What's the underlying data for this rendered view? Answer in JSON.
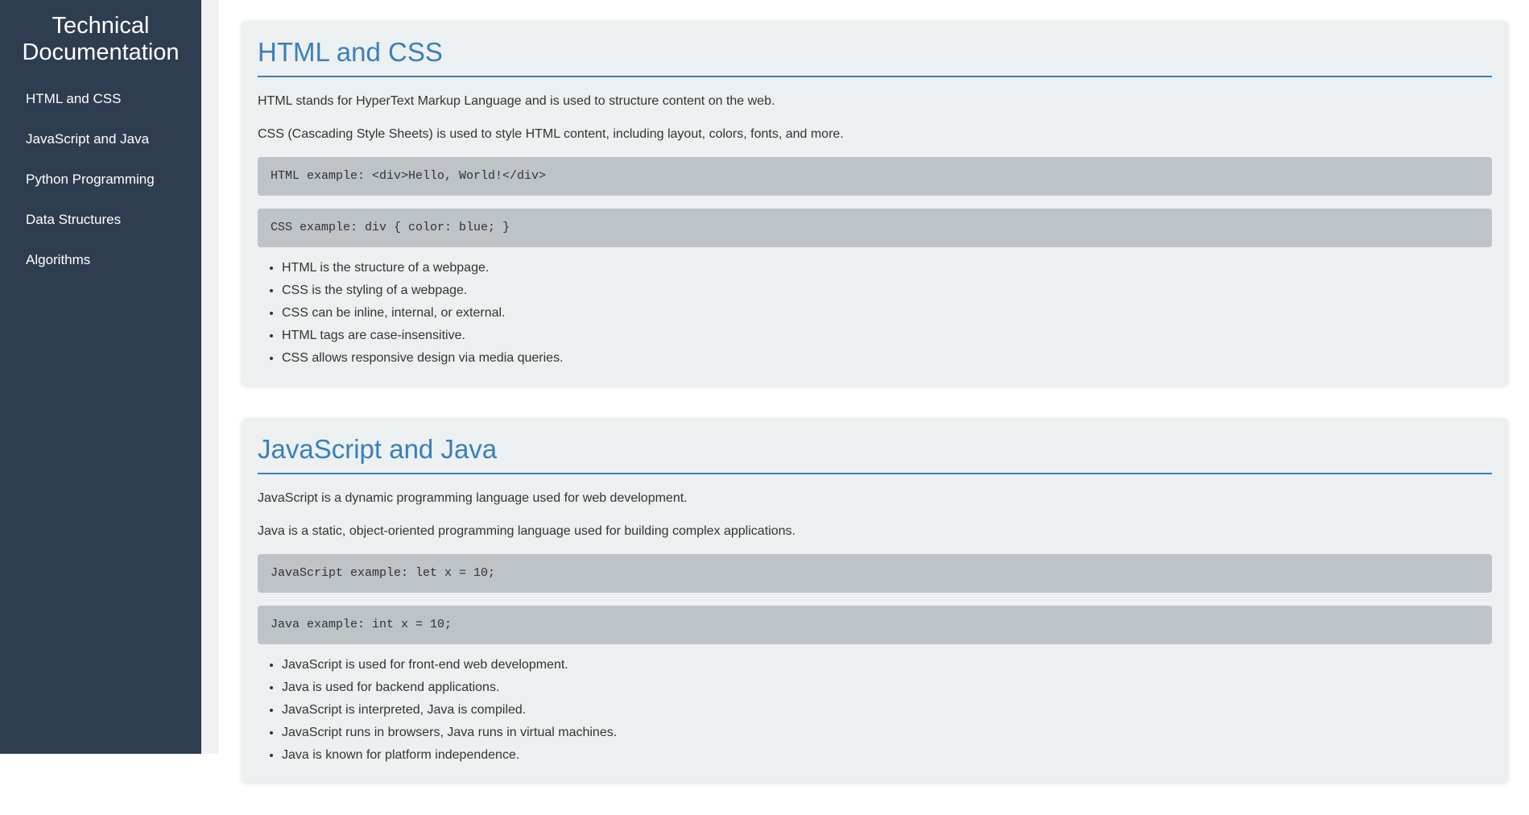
{
  "sidebar": {
    "title_line1": "Technical",
    "title_line2": "Documentation",
    "items": [
      {
        "label": "HTML and CSS"
      },
      {
        "label": "JavaScript and Java"
      },
      {
        "label": "Python Programming"
      },
      {
        "label": "Data Structures"
      },
      {
        "label": "Algorithms"
      }
    ]
  },
  "sections": [
    {
      "title": "HTML and CSS",
      "paragraphs": [
        "HTML stands for HyperText Markup Language and is used to structure content on the web.",
        "CSS (Cascading Style Sheets) is used to style HTML content, including layout, colors, fonts, and more."
      ],
      "code": [
        "HTML example: <div>Hello, World!</div>",
        "CSS example: div { color: blue; }"
      ],
      "bullets": [
        "HTML is the structure of a webpage.",
        "CSS is the styling of a webpage.",
        "CSS can be inline, internal, or external.",
        "HTML tags are case-insensitive.",
        "CSS allows responsive design via media queries."
      ]
    },
    {
      "title": "JavaScript and Java",
      "paragraphs": [
        "JavaScript is a dynamic programming language used for web development.",
        "Java is a static, object-oriented programming language used for building complex applications."
      ],
      "code": [
        "JavaScript example: let x = 10;",
        "Java example: int x = 10;"
      ],
      "bullets": [
        "JavaScript is used for front-end web development.",
        "Java is used for backend applications.",
        "JavaScript is interpreted, Java is compiled.",
        "JavaScript runs in browsers, Java runs in virtual machines.",
        "Java is known for platform independence."
      ]
    }
  ],
  "colors": {
    "sidebar_bg": "#2e3d50",
    "accent": "#3a7fbd",
    "section_bg": "#ecf0f1",
    "code_bg": "#bdc3c7"
  }
}
